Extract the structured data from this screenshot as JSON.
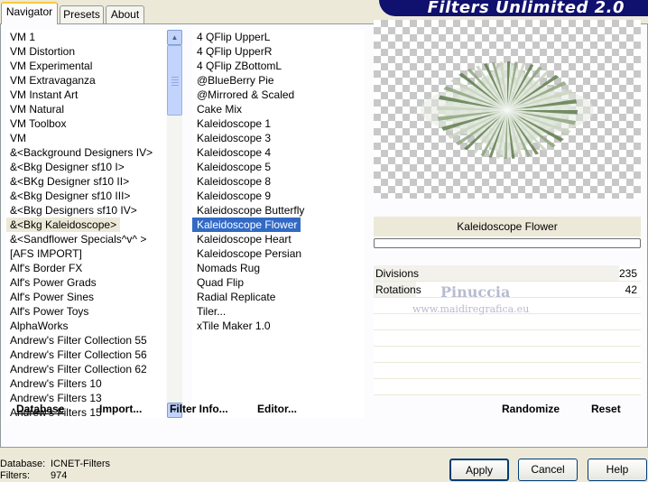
{
  "tabs": [
    "Navigator",
    "Presets",
    "About"
  ],
  "banner_title": "Filters Unlimited 2.0",
  "categories": [
    "VM 1",
    "VM Distortion",
    "VM Experimental",
    "VM Extravaganza",
    "VM Instant Art",
    "VM Natural",
    "VM Toolbox",
    "VM",
    "&<Background Designers IV>",
    "&<Bkg Designer sf10 I>",
    "&<BKg Designer sf10 II>",
    "&<Bkg Designer sf10 III>",
    "&<Bkg Designers sf10 IV>",
    "&<Bkg Kaleidoscope>",
    "&<Sandflower Specials^v^ >",
    "[AFS IMPORT]",
    "Alf's Border FX",
    "Alf's Power Grads",
    "Alf's Power Sines",
    "Alf's Power Toys",
    "AlphaWorks",
    "Andrew's Filter Collection 55",
    "Andrew's Filter Collection 56",
    "Andrew's Filter Collection 62",
    "Andrew's Filters 10",
    "Andrew's Filters 13",
    "Andrew's Filters 15"
  ],
  "selected_category": "&<Bkg Kaleidoscope>",
  "filters": [
    "4 QFlip UpperL",
    "4 QFlip UpperR",
    "4 QFlip ZBottomL",
    "@BlueBerry Pie",
    "@Mirrored & Scaled",
    "Cake Mix",
    "Kaleidoscope 1",
    "Kaleidoscope 3",
    "Kaleidoscope 4",
    "Kaleidoscope 5",
    "Kaleidoscope 8",
    "Kaleidoscope 9",
    "Kaleidoscope Butterfly",
    "Kaleidoscope Flower",
    "Kaleidoscope Heart",
    "Kaleidoscope Persian",
    "Nomads Rug",
    "Quad Flip",
    "Radial Replicate",
    "Tiler...",
    "xTile Maker 1.0"
  ],
  "selected_filter": "Kaleidoscope Flower",
  "preview_filter_name": "Kaleidoscope Flower",
  "params": [
    {
      "name": "Divisions",
      "value": "235",
      "fill": 0.92
    },
    {
      "name": "Rotations",
      "value": "42",
      "fill": 0.16
    }
  ],
  "watermark": {
    "line1": "Pinuccia",
    "line2": "www.maidiregrafica.eu"
  },
  "actions": {
    "database": "Database",
    "import": "Import...",
    "filter_info": "Filter Info...",
    "editor": "Editor...",
    "randomize": "Randomize",
    "reset": "Reset"
  },
  "status": {
    "database_label": "Database:",
    "database_value": "ICNET-Filters",
    "filters_label": "Filters:",
    "filters_value": "974"
  },
  "buttons": {
    "apply": "Apply",
    "cancel": "Cancel",
    "help": "Help"
  },
  "colors": {
    "selection": "#316ac5",
    "banner": "#10106e",
    "preview_green": "#6b8a5a"
  }
}
